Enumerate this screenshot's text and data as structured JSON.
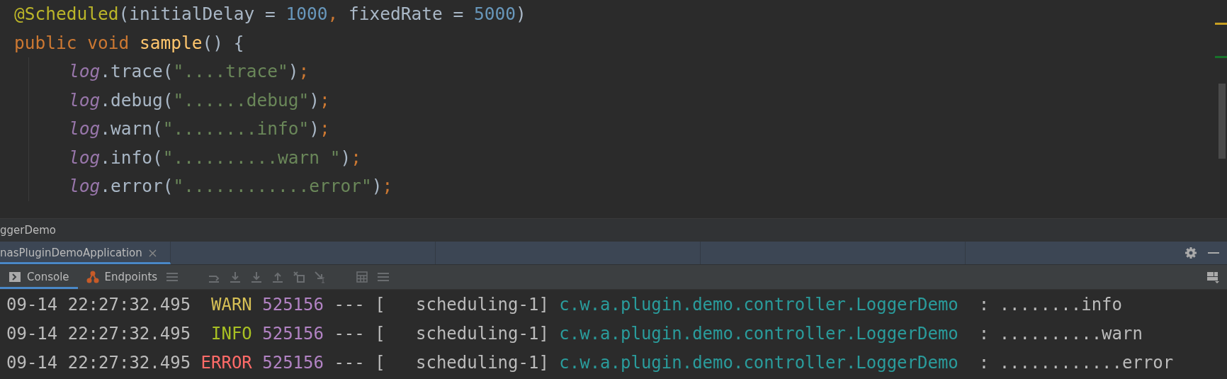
{
  "editor": {
    "lines": [
      {
        "indent": false,
        "tokens": [
          {
            "kind": "annotation",
            "text": "@Scheduled"
          },
          {
            "kind": "plain",
            "text": "(initialDelay = "
          },
          {
            "kind": "number",
            "text": "1000"
          },
          {
            "kind": "keyword",
            "text": ","
          },
          {
            "kind": "plain",
            "text": " fixedRate = "
          },
          {
            "kind": "number",
            "text": "5000"
          },
          {
            "kind": "plain",
            "text": ")"
          }
        ]
      },
      {
        "indent": false,
        "tokens": [
          {
            "kind": "keyword",
            "text": "public void "
          },
          {
            "kind": "method",
            "text": "sample"
          },
          {
            "kind": "plain",
            "text": "() {"
          }
        ]
      },
      {
        "indent": true,
        "tokens": [
          {
            "kind": "field",
            "text": "log"
          },
          {
            "kind": "plain",
            "text": ".trace("
          },
          {
            "kind": "string",
            "text": "\"....trace\""
          },
          {
            "kind": "plain",
            "text": ")"
          },
          {
            "kind": "keyword",
            "text": ";"
          }
        ]
      },
      {
        "indent": true,
        "tokens": [
          {
            "kind": "field",
            "text": "log"
          },
          {
            "kind": "plain",
            "text": ".debug("
          },
          {
            "kind": "string",
            "text": "\"......debug\""
          },
          {
            "kind": "plain",
            "text": ")"
          },
          {
            "kind": "keyword",
            "text": ";"
          }
        ]
      },
      {
        "indent": true,
        "tokens": [
          {
            "kind": "field",
            "text": "log"
          },
          {
            "kind": "plain",
            "text": ".warn("
          },
          {
            "kind": "string",
            "text": "\"........info\""
          },
          {
            "kind": "plain",
            "text": ")"
          },
          {
            "kind": "keyword",
            "text": ";"
          }
        ]
      },
      {
        "indent": true,
        "tokens": [
          {
            "kind": "field",
            "text": "log"
          },
          {
            "kind": "plain",
            "text": ".info("
          },
          {
            "kind": "string",
            "text": "\"..........warn \""
          },
          {
            "kind": "plain",
            "text": ")"
          },
          {
            "kind": "keyword",
            "text": ";"
          }
        ]
      },
      {
        "indent": true,
        "tokens": [
          {
            "kind": "field",
            "text": "log"
          },
          {
            "kind": "plain",
            "text": ".error("
          },
          {
            "kind": "string",
            "text": "\"............error\""
          },
          {
            "kind": "plain",
            "text": ")"
          },
          {
            "kind": "keyword",
            "text": ";"
          }
        ]
      }
    ]
  },
  "breadcrumb": "ggerDemo",
  "run_tabs": [
    {
      "label": "nasPluginDemoApplication",
      "selected": true
    }
  ],
  "tool_tabs": [
    {
      "label": "Console",
      "kind": "console",
      "selected": true
    },
    {
      "label": "Endpoints",
      "kind": "endpoints",
      "selected": false
    }
  ],
  "console": {
    "rows": [
      {
        "timestamp": "09-14 22:27:32.495",
        "level": "WARN",
        "kind": "warn",
        "pid": "525156",
        "separator": "--- [",
        "thread": "   scheduling-1]",
        "logger": "c.w.a.plugin.demo.controller.LoggerDemo",
        "message": " : ........info"
      },
      {
        "timestamp": "09-14 22:27:32.495",
        "level": "INFO",
        "kind": "info",
        "pid": "525156",
        "separator": "--- [",
        "thread": "   scheduling-1]",
        "logger": "c.w.a.plugin.demo.controller.LoggerDemo",
        "message": " : ..........warn"
      },
      {
        "timestamp": "09-14 22:27:32.495",
        "level": "ERROR",
        "kind": "error",
        "pid": "525156",
        "separator": "--- [",
        "thread": "   scheduling-1]",
        "logger": "c.w.a.plugin.demo.controller.LoggerDemo",
        "message": " : ............error"
      }
    ]
  }
}
